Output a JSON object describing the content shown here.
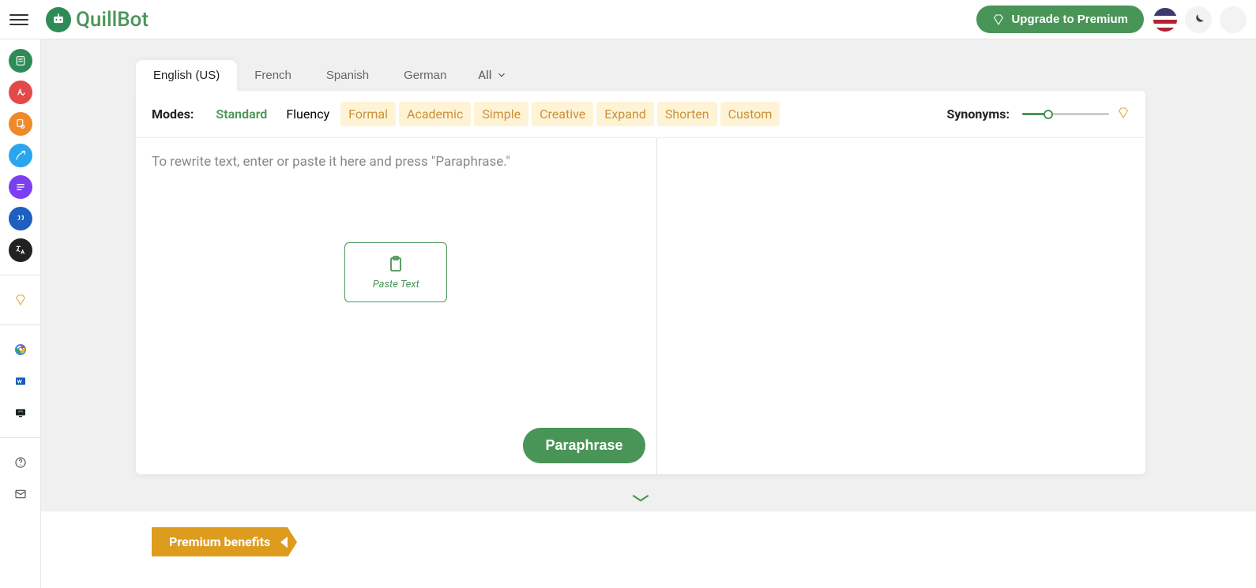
{
  "header": {
    "logo_text": "QuillBot",
    "upgrade_label": "Upgrade to Premium"
  },
  "sidebar": {
    "items": [
      {
        "name": "paraphraser-icon",
        "bg": "#2e8b57"
      },
      {
        "name": "grammar-checker-icon",
        "bg": "#e24a4a"
      },
      {
        "name": "plagiarism-checker-icon",
        "bg": "#ef8a2a"
      },
      {
        "name": "cowriter-icon",
        "bg": "#2aa5ef"
      },
      {
        "name": "summarizer-icon",
        "bg": "#7b3ff2"
      },
      {
        "name": "citation-generator-icon",
        "bg": "#1e5fbf"
      },
      {
        "name": "translator-icon",
        "bg": "#222222"
      }
    ],
    "premium_icon": "premium-diamond-icon",
    "ext_chrome": "chrome-extension-icon",
    "ext_word": "word-extension-icon",
    "ext_macos": "desktop-extension-icon",
    "help_icon": "help-icon",
    "contact_icon": "contact-icon"
  },
  "languages": {
    "tabs": [
      "English (US)",
      "French",
      "Spanish",
      "German"
    ],
    "active_index": 0,
    "all_label": "All"
  },
  "modes": {
    "label": "Modes:",
    "items": [
      {
        "label": "Standard",
        "state": "active"
      },
      {
        "label": "Fluency",
        "state": "normal"
      },
      {
        "label": "Formal",
        "state": "premium"
      },
      {
        "label": "Academic",
        "state": "premium"
      },
      {
        "label": "Simple",
        "state": "premium"
      },
      {
        "label": "Creative",
        "state": "premium"
      },
      {
        "label": "Expand",
        "state": "premium"
      },
      {
        "label": "Shorten",
        "state": "premium"
      },
      {
        "label": "Custom",
        "state": "premium"
      }
    ],
    "synonyms_label": "Synonyms:"
  },
  "editor": {
    "placeholder": "To rewrite text, enter or paste it here and press \"Paraphrase.\"",
    "paste_label": "Paste Text",
    "paraphrase_button": "Paraphrase"
  },
  "footer": {
    "premium_benefits": "Premium benefits"
  }
}
